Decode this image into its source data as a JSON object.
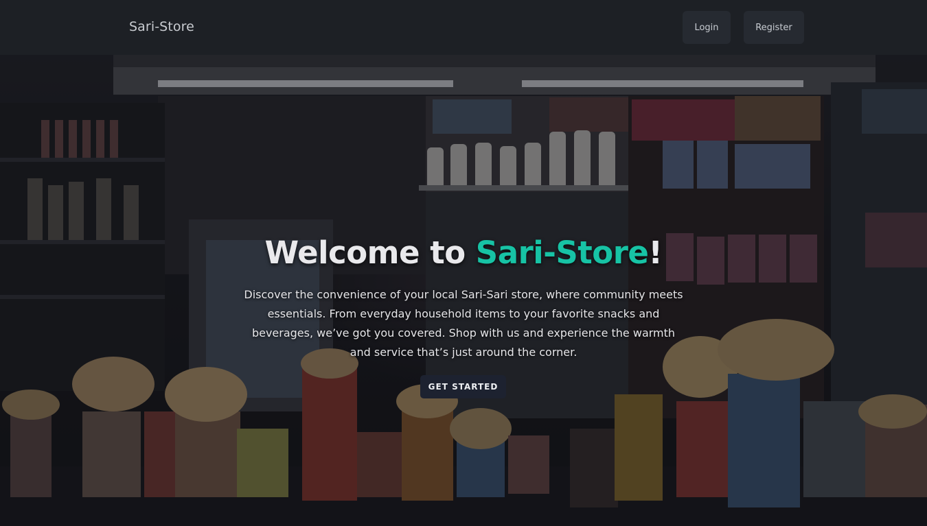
{
  "navbar": {
    "brand": "Sari-Store",
    "login_label": "Login",
    "register_label": "Register"
  },
  "hero": {
    "title_prefix": "Welcome to ",
    "title_accent": "Sari-Store",
    "title_suffix": "!",
    "description": "Discover the convenience of your local Sari-Sari store, where community meets essentials. From everyday household items to your favorite snacks and beverages, we’ve got you covered. Shop with us and experience the warmth and service that’s just around the corner.",
    "cta_label": "GET STARTED"
  },
  "colors": {
    "accent": "#17c3a5",
    "navbar_bg": "#1d2025",
    "button_bg": "#262a31",
    "cta_bg": "#1d2230"
  }
}
